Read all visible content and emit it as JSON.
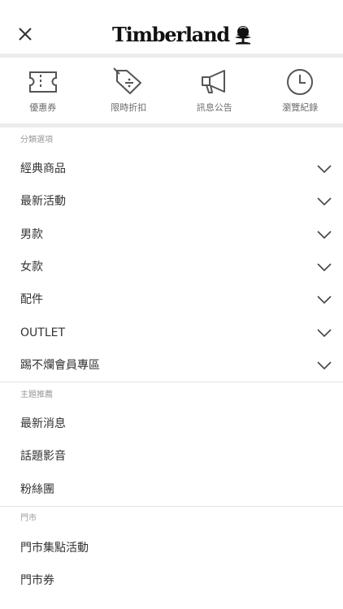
{
  "header": {
    "brand": "Timberland",
    "close_icon": "close-icon",
    "tree_icon": "tree-logo-icon"
  },
  "quick_links": [
    {
      "label": "優惠券",
      "icon": "ticket-icon"
    },
    {
      "label": "限時折扣",
      "icon": "discount-tag-icon"
    },
    {
      "label": "訊息公告",
      "icon": "megaphone-icon"
    },
    {
      "label": "瀏覽紀錄",
      "icon": "clock-icon"
    }
  ],
  "categories": {
    "title": "分類選項",
    "items": [
      {
        "label": "經典商品"
      },
      {
        "label": "最新活動"
      },
      {
        "label": "男款"
      },
      {
        "label": "女款"
      },
      {
        "label": "配件"
      },
      {
        "label": "OUTLET"
      },
      {
        "label": "踢不爛會員專區"
      }
    ]
  },
  "topics": {
    "title": "主題推薦",
    "items": [
      {
        "label": "最新消息"
      },
      {
        "label": "話題影音"
      },
      {
        "label": "粉絲團"
      }
    ]
  },
  "stores": {
    "title": "門市",
    "items": [
      {
        "label": "門市集點活動"
      },
      {
        "label": "門市券"
      }
    ]
  },
  "colors": {
    "text": "#333333",
    "muted": "#9a9a9a",
    "icon": "#555555",
    "divider": "#e4e4e4",
    "band": "#ececec"
  }
}
